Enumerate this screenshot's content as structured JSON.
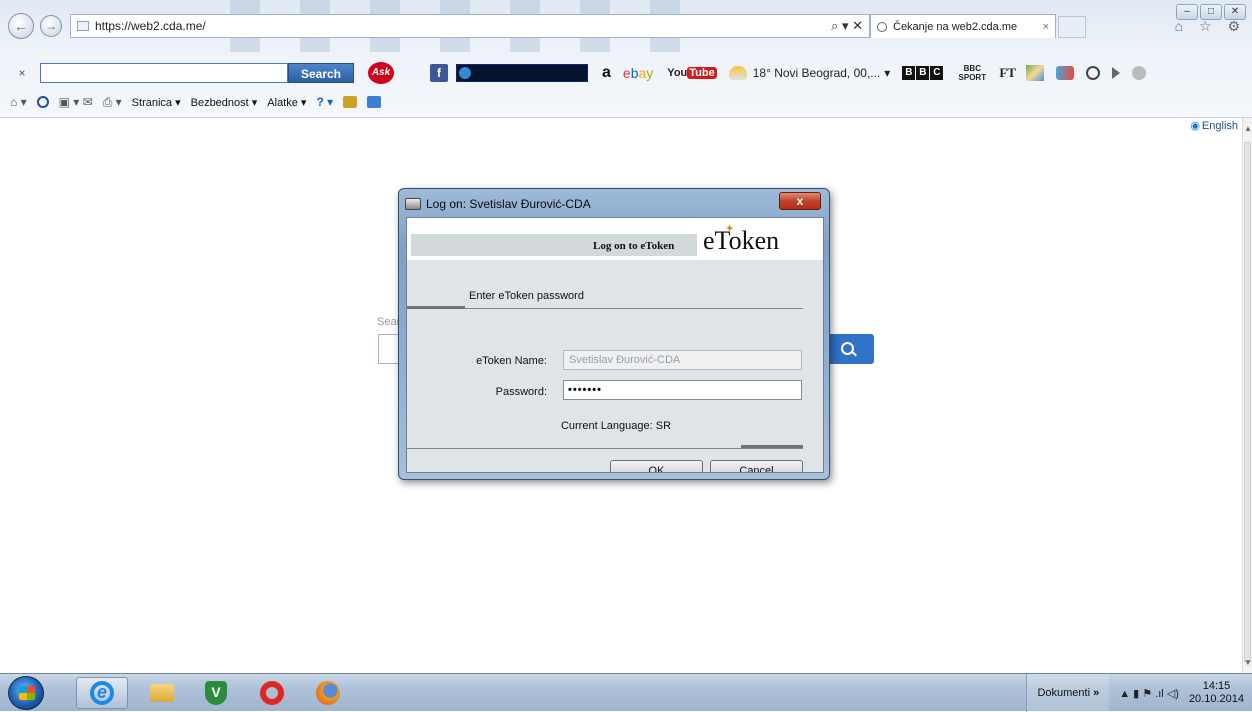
{
  "browser": {
    "address_url": "https://web2.cda.me/",
    "address_tools": "⌕ ▾ ✕",
    "tab_title": "Čekanje na web2.cda.me",
    "tab_close": "×",
    "window_controls": [
      "–",
      "□",
      "✕"
    ],
    "favorites_icons": "⌂ ☆ ⚙"
  },
  "toolbar": {
    "close_glyph": "×",
    "search_button": "Search",
    "ask_label": "Ask",
    "facebook_label": "f",
    "amazon_label": "a",
    "ebay_letters": [
      "e",
      "b",
      "a",
      "y"
    ],
    "youtube_you": "You",
    "youtube_tube": "Tube",
    "weather": "18° Novi Beograd, 00,...",
    "weather_arrow": "▾",
    "bbc_letters": [
      "B",
      "B",
      "C"
    ],
    "bbc_sport": "BBC SPORT",
    "ft_label": "FT"
  },
  "command_bar": {
    "items": [
      "Stranica ▾",
      "Bezbednost ▾",
      "Alatke ▾"
    ],
    "home_glyph": "⌂ ▾",
    "misc_glyphs": "▣ ▾ ✉",
    "print_glyph": "⎙ ▾",
    "help_glyph": "? ▾"
  },
  "page": {
    "language_link": "English",
    "search_label": "Sear"
  },
  "dialog": {
    "title": "Log on: Svetislav Đurović-CDA",
    "close_label": "x",
    "banner_text": "Log on to eToken",
    "brand": "eToken",
    "subtitle": "Enter eToken password",
    "name_label": "eToken Name:",
    "name_value": "Svetislav Đurović-CDA",
    "password_label": "Password:",
    "password_value": "•••••••",
    "language_line": "Current Language: SR",
    "ok_label": "OK",
    "cancel_label": "Cancel"
  },
  "taskbar": {
    "toolbar_label": "Dokumenti",
    "toolbar_chevron": "»",
    "tray_icons": "▲  ▮  ⚑  .ıl  ◁)",
    "time": "14:15",
    "date": "20.10.2014",
    "shield_glyph": "V",
    "ie_glyph": "e"
  }
}
